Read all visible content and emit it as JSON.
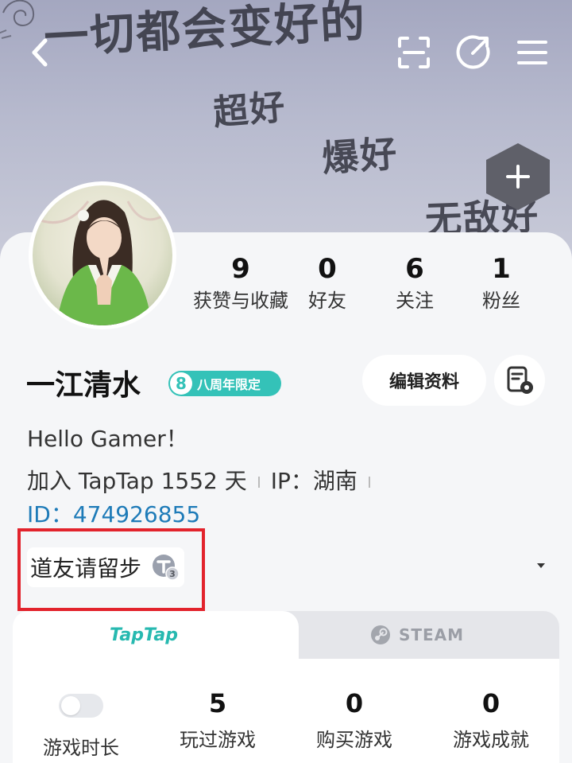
{
  "banner": {
    "lines": [
      "一切都会变好的",
      "超好",
      "爆好",
      "无敌好"
    ]
  },
  "stats": [
    {
      "value": "9",
      "label": "获赞与收藏"
    },
    {
      "value": "0",
      "label": "好友"
    },
    {
      "value": "6",
      "label": "关注"
    },
    {
      "value": "1",
      "label": "粉丝"
    }
  ],
  "profile": {
    "name": "一江清水",
    "badge_number": "8",
    "badge_text": "八周年限定",
    "edit_label": "编辑资料",
    "bio": "Hello Gamer！",
    "joined": "加入 TapTap 1552 天",
    "ip": "IP：湖南",
    "id": "ID：474926855",
    "signature": "道友请留步",
    "signature_level": "3"
  },
  "tabs": {
    "taptap": "TapTap",
    "steam": "STEAM"
  },
  "game_stats": [
    {
      "value": "",
      "label": "游戏时长",
      "toggle": true
    },
    {
      "value": "5",
      "label": "玩过游戏"
    },
    {
      "value": "0",
      "label": "购买游戏"
    },
    {
      "value": "0",
      "label": "游戏成就"
    }
  ],
  "colors": {
    "accent": "#34c2b8",
    "id_blue": "#1e7bb8",
    "highlight_red": "#e2232c"
  }
}
